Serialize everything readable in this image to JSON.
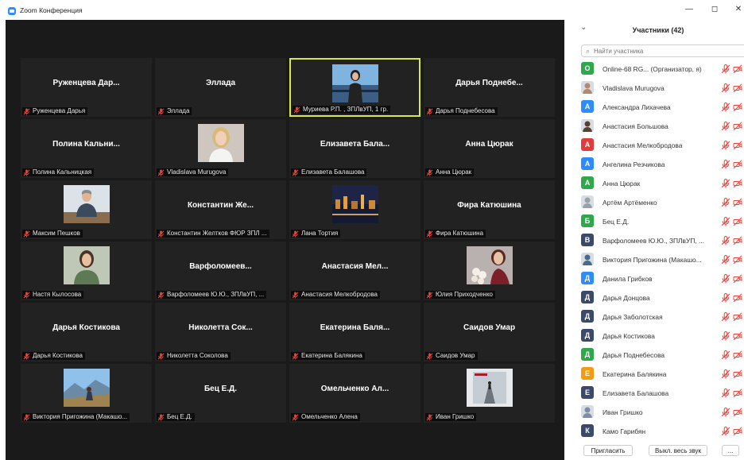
{
  "window": {
    "title": "Zoom Конференция",
    "controls": [
      "—",
      "◻",
      "✕"
    ]
  },
  "gallery": {
    "tiles": [
      {
        "display_name": "Руженцева Дар...",
        "label": "Руженцева Дарья",
        "video": false,
        "muted": true
      },
      {
        "display_name": "Эллада",
        "label": "Эллада",
        "video": false,
        "muted": true
      },
      {
        "display_name": "",
        "label": "Муриева Р.П. , ЗПЛвУП, 1 гр.",
        "video": true,
        "muted": true,
        "active": true,
        "photo": "young-woman-by-sea-railing"
      },
      {
        "display_name": "Дарья Поднебе...",
        "label": "Дарья Поднебесова",
        "video": false,
        "muted": true
      },
      {
        "display_name": "Полина Кальни...",
        "label": "Полина Кальницкая",
        "video": false,
        "muted": true
      },
      {
        "display_name": "",
        "label": "Vladislava Murugova",
        "video": true,
        "muted": true,
        "photo": "blonde-woman-portrait"
      },
      {
        "display_name": "Елизавета Бала...",
        "label": "Елизавета Балашова",
        "video": false,
        "muted": true
      },
      {
        "display_name": "Анна Цюрак",
        "label": "Анна Цюрак",
        "video": false,
        "muted": true
      },
      {
        "display_name": "",
        "label": "Максим Пешков",
        "video": true,
        "muted": true,
        "photo": "man-in-suit-at-desk"
      },
      {
        "display_name": "Константин Же...",
        "label": "Константин Желтков ФЮР ЗПЛ ...",
        "video": false,
        "muted": true
      },
      {
        "display_name": "",
        "label": "Лана Тортия",
        "video": true,
        "muted": true,
        "photo": "night-city-skyline"
      },
      {
        "display_name": "Фира Катюшина",
        "label": "Фира Катюшина",
        "video": false,
        "muted": true
      },
      {
        "display_name": "",
        "label": "Настя Кылосова",
        "video": true,
        "muted": true,
        "photo": "woman-in-green-room"
      },
      {
        "display_name": "Варфоломеев...",
        "label": "Варфоломеев Ю.Ю., ЗПЛвУП, ...",
        "video": false,
        "muted": true
      },
      {
        "display_name": "Анастасия Мел...",
        "label": "Анастасия Мелкобродова",
        "video": false,
        "muted": true
      },
      {
        "display_name": "",
        "label": "Юлия Приходченко",
        "video": true,
        "muted": true,
        "photo": "woman-with-roses"
      },
      {
        "display_name": "Дарья Костикова",
        "label": "Дарья Костикова",
        "video": false,
        "muted": true
      },
      {
        "display_name": "Николетта Сок...",
        "label": "Николетта Соколова",
        "video": false,
        "muted": true
      },
      {
        "display_name": "Екатерина Баля...",
        "label": "Екатерина Балякина",
        "video": false,
        "muted": true
      },
      {
        "display_name": "Саидов Умар",
        "label": "Саидов Умар",
        "video": false,
        "muted": true
      },
      {
        "display_name": "",
        "label": "Виктория Пригожина (Макашо...",
        "video": true,
        "muted": true,
        "photo": "person-on-mountain"
      },
      {
        "display_name": "Бец Е.Д.",
        "label": "Бец Е.Д.",
        "video": false,
        "muted": true
      },
      {
        "display_name": "Омельченко Ал...",
        "label": "Омельченко Алена",
        "video": false,
        "muted": true
      },
      {
        "display_name": "",
        "label": "Иван Гришко",
        "video": true,
        "muted": true,
        "photo": "man-on-road-poster"
      }
    ]
  },
  "participants_panel": {
    "collapse_icon": "chevron-down-icon",
    "title": "Участники (42)",
    "search_placeholder": "Найти участника",
    "participants": [
      {
        "initial": "O",
        "color": "#2EA84B",
        "name": "Online-68 RG... (Организатор, я)",
        "avatar": "letter"
      },
      {
        "initial": "",
        "color": "#b08a70",
        "name": "Vladislava Murugova",
        "avatar": "photo"
      },
      {
        "initial": "А",
        "color": "#2D8CFF",
        "name": "Александра Лихачева",
        "avatar": "letter"
      },
      {
        "initial": "",
        "color": "#5a4030",
        "name": "Анастасия Большова",
        "avatar": "photo"
      },
      {
        "initial": "А",
        "color": "#E03C3C",
        "name": "Анастасия Мелкобродова",
        "avatar": "letter"
      },
      {
        "initial": "А",
        "color": "#2D8CFF",
        "name": "Ангелина Резчикова",
        "avatar": "letter"
      },
      {
        "initial": "А",
        "color": "#2EA84B",
        "name": "Анна Цюрак",
        "avatar": "letter"
      },
      {
        "initial": "",
        "color": "#9aa0a8",
        "name": "Артём Артёменко",
        "avatar": "photo"
      },
      {
        "initial": "Б",
        "color": "#2EA84B",
        "name": "Бец Е.Д.",
        "avatar": "letter"
      },
      {
        "initial": "В",
        "color": "#3B4A6B",
        "name": "Варфоломеев Ю.Ю., ЗПЛвУП, ...",
        "avatar": "letter"
      },
      {
        "initial": "",
        "color": "#4a6a8a",
        "name": "Виктория Пригожина (Макашо...",
        "avatar": "photo"
      },
      {
        "initial": "Д",
        "color": "#2D8CFF",
        "name": "Данила Грибков",
        "avatar": "letter"
      },
      {
        "initial": "Д",
        "color": "#3B4A6B",
        "name": "Дарья Донцова",
        "avatar": "letter"
      },
      {
        "initial": "Д",
        "color": "#3B4A6B",
        "name": "Дарья Заболотская",
        "avatar": "letter"
      },
      {
        "initial": "Д",
        "color": "#3B4A6B",
        "name": "Дарья Костикова",
        "avatar": "letter"
      },
      {
        "initial": "Д",
        "color": "#2EA84B",
        "name": "Дарья Поднебесова",
        "avatar": "letter"
      },
      {
        "initial": "Е",
        "color": "#F39C12",
        "name": "Екатерина Балякина",
        "avatar": "letter"
      },
      {
        "initial": "Е",
        "color": "#3B4A6B",
        "name": "Елизавета Балашова",
        "avatar": "letter"
      },
      {
        "initial": "",
        "color": "#7a8fa6",
        "name": "Иван Гришко",
        "avatar": "photo"
      },
      {
        "initial": "К",
        "color": "#3B4A6B",
        "name": "Камо Гарибян",
        "avatar": "letter"
      }
    ],
    "footer": {
      "invite": "Пригласить",
      "mute_all": "Выкл. весь звук",
      "more": "..."
    }
  },
  "colors": {
    "gallery_bg": "#1a1a1a",
    "tile_bg": "#222222",
    "active_speaker_border": "#d6e84a",
    "muted_icon": "#e5483d",
    "zoom_blue": "#2D8CFF"
  }
}
